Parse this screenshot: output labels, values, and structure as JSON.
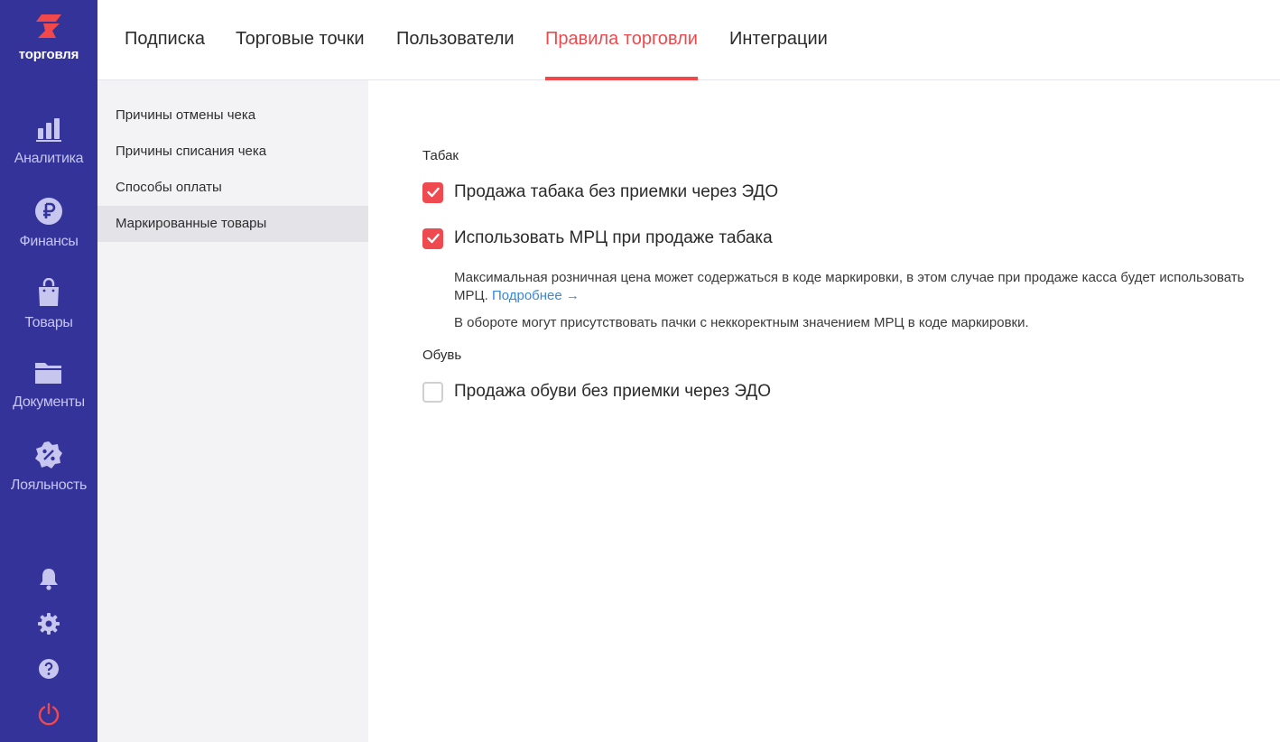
{
  "app": {
    "logo_text": "торговля",
    "accent": "#f1484b",
    "rail_bg": "#34339a"
  },
  "rail": {
    "items": [
      {
        "label": "Аналитика",
        "icon": "bar-chart-icon"
      },
      {
        "label": "Финансы",
        "icon": "ruble-icon"
      },
      {
        "label": "Товары",
        "icon": "shopping-bag-icon"
      },
      {
        "label": "Документы",
        "icon": "folder-icon"
      },
      {
        "label": "Лояльность",
        "icon": "discount-badge-icon"
      }
    ],
    "bottom": [
      "bell-icon",
      "gear-icon",
      "help-icon",
      "power-icon"
    ]
  },
  "tabs": [
    {
      "label": "Подписка"
    },
    {
      "label": "Торговые точки"
    },
    {
      "label": "Пользователи"
    },
    {
      "label": "Правила торговли",
      "active": true
    },
    {
      "label": "Интеграции"
    }
  ],
  "submenu": [
    {
      "label": "Причины отмены чека"
    },
    {
      "label": "Причины списания чека"
    },
    {
      "label": "Способы оплаты"
    },
    {
      "label": "Маркированные товары",
      "active": true
    }
  ],
  "sections": {
    "tobacco": {
      "title": "Табак",
      "opt1": {
        "label": "Продажа табака без приемки через ЭДО",
        "checked": true
      },
      "opt2": {
        "label": "Использовать МРЦ при продаже табака",
        "checked": true
      },
      "hint1": "Максимальная розничная цена может содержаться в коде маркировки, в этом случае при продаже касса будет использовать МРЦ.",
      "hint_link": "Подробнее →",
      "hint2": "В обороте могут присутствовать пачки с неккоректным значением МРЦ в коде маркировки."
    },
    "shoes": {
      "title": "Обувь",
      "opt1": {
        "label": "Продажа обуви без приемки через ЭДО",
        "checked": false
      }
    }
  }
}
